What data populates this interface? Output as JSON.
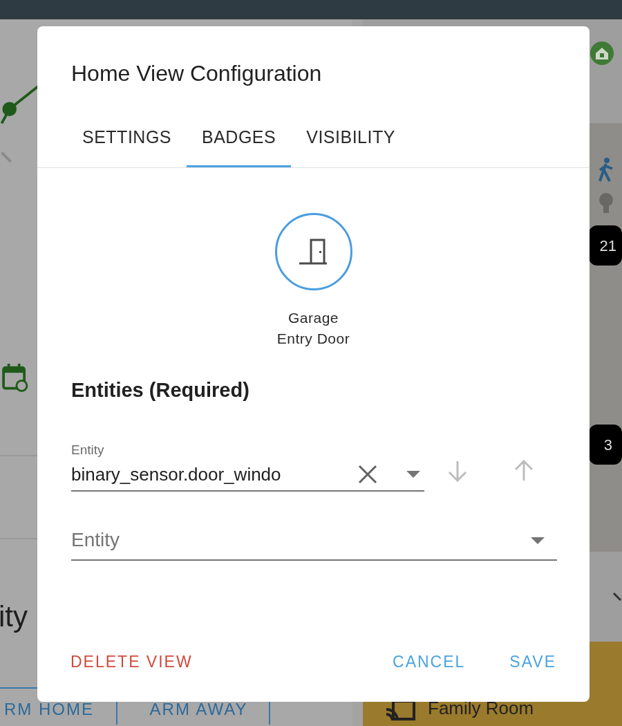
{
  "background": {
    "left_heading_fragment": "ity",
    "alarm_buttons": [
      "RM HOME",
      "ARM AWAY"
    ],
    "floorplan_badges": [
      "21",
      "3"
    ],
    "media_player": "Family Room"
  },
  "dialog": {
    "title": "Home View Configuration",
    "tabs": [
      {
        "label": "SETTINGS",
        "selected": false
      },
      {
        "label": "BADGES",
        "selected": true
      },
      {
        "label": "VISIBILITY",
        "selected": false
      }
    ],
    "badge_preview": {
      "name": "Garage Entry Door"
    },
    "section_title": "Entities (Required)",
    "entities": [
      {
        "label": "Entity",
        "value": "binary_sensor.door_windo"
      },
      {
        "placeholder": "Entity"
      }
    ],
    "buttons": [
      {
        "label": "DELETE VIEW",
        "kind": "danger"
      },
      {
        "label": "CANCEL",
        "kind": "text"
      },
      {
        "label": "SAVE",
        "kind": "text"
      }
    ]
  }
}
